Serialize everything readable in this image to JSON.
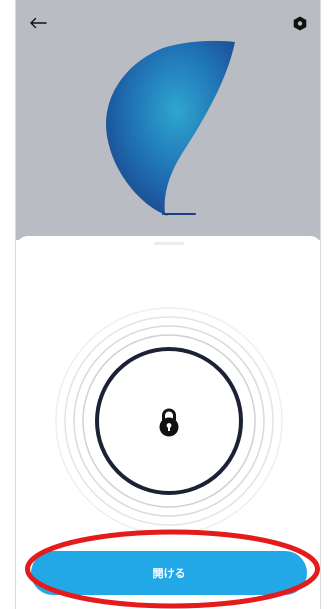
{
  "header": {
    "back_icon": "arrow-left-icon",
    "settings_icon": "hexagon-settings-icon"
  },
  "brand": {
    "art_icon": "blue-teardrop-logo",
    "accent_color": "#1f6fb3"
  },
  "lock": {
    "icon": "padlock-icon",
    "ring_color": "#1b2233"
  },
  "action": {
    "open_label": "開ける",
    "color": "#22a8e6"
  },
  "annotation": {
    "highlight_color": "#e51b1b"
  }
}
